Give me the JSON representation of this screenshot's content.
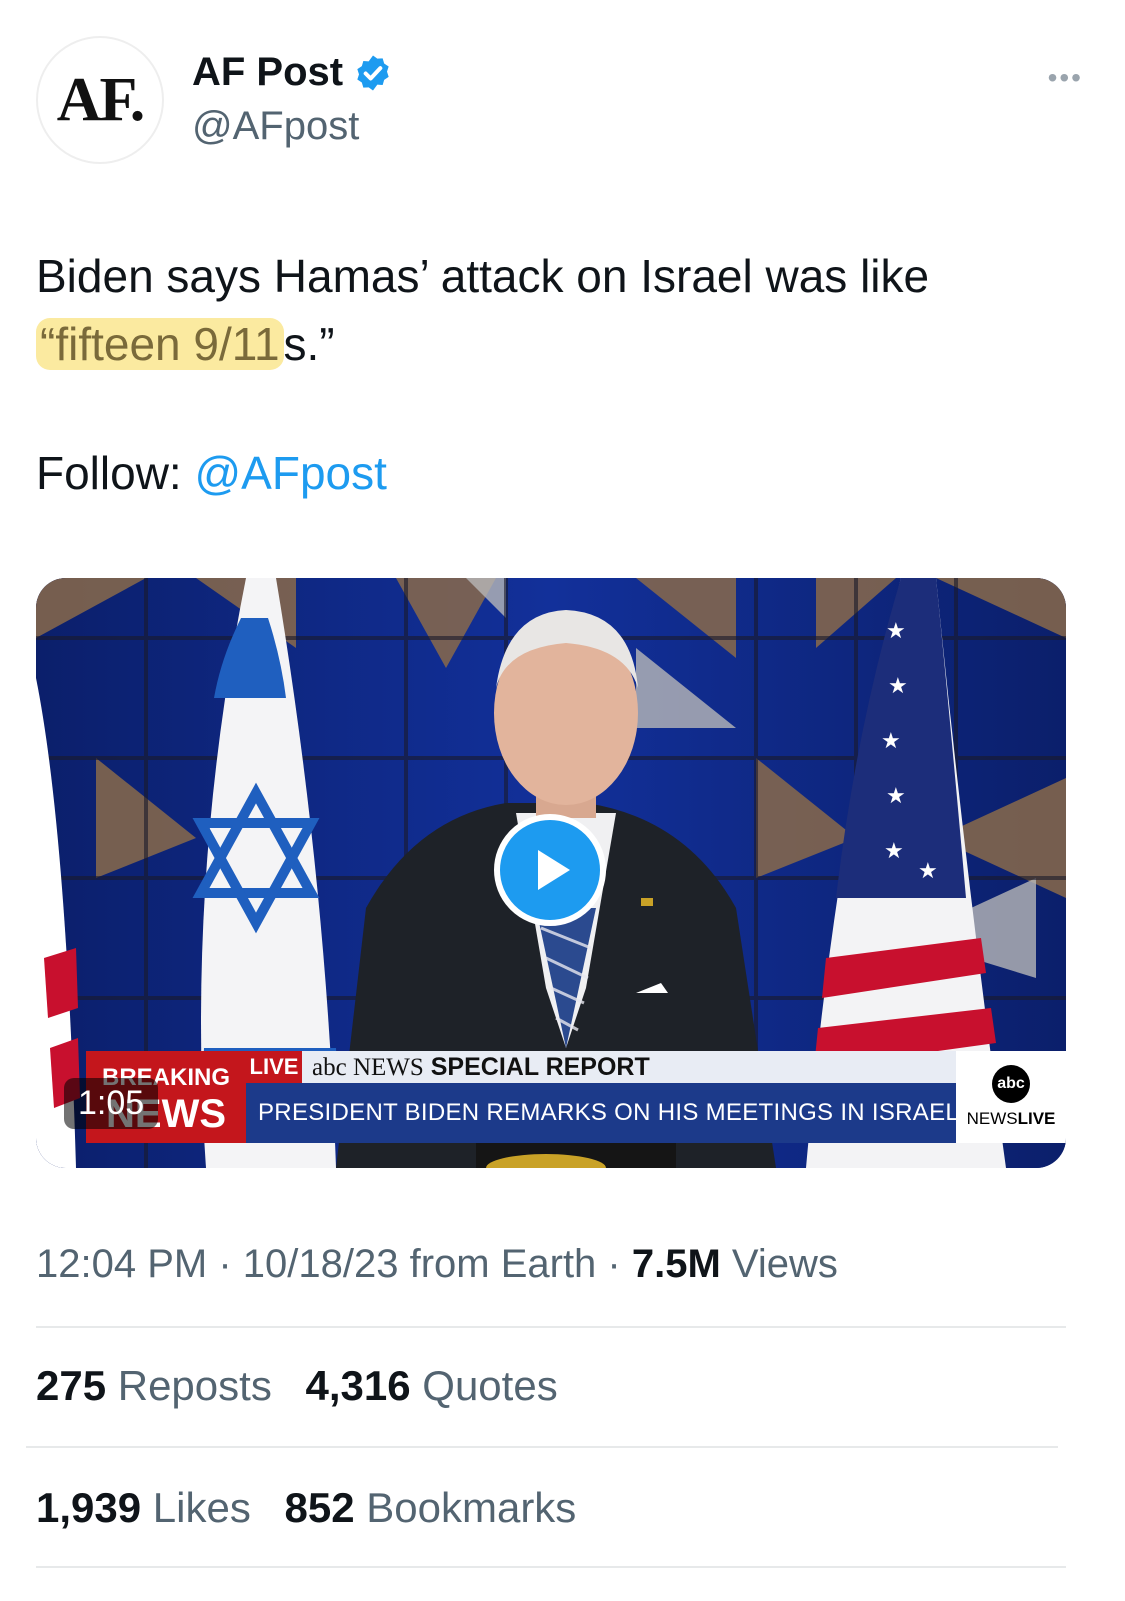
{
  "account": {
    "avatar_text": "AF.",
    "display_name": "AF Post",
    "handle": "@AFpost",
    "more_label": "•••"
  },
  "tweet": {
    "text_before": "Biden says Hamas’ attack on Israel was like ",
    "highlighted": "“fifteen 9/11",
    "text_after": "s.”",
    "follow_label": "Follow: ",
    "follow_mention": "@AFpost"
  },
  "media": {
    "duration": "1:05",
    "breaking_top": "BREAKING",
    "breaking_bottom": "NEWS",
    "live": "LIVE",
    "network": "abc NEWS",
    "special_report": "SPECIAL REPORT",
    "headline": "PRESIDENT BIDEN REMARKS ON HIS MEETINGS IN ISRAEL",
    "logo_circle": "abc",
    "logo_news": "NEWS",
    "logo_live": "LIVE",
    "play_icon": "play-icon"
  },
  "meta": {
    "time": "12:04 PM",
    "sep": " · ",
    "date": "10/18/23",
    "source": " from Earth",
    "views_count": "7.5M",
    "views_label": " Views"
  },
  "stats": {
    "reposts_count": "275",
    "reposts_label": " Reposts",
    "quotes_count": "4,316",
    "quotes_label": " Quotes",
    "likes_count": "1,939",
    "likes_label": " Likes",
    "bookmarks_count": "852",
    "bookmarks_label": " Bookmarks"
  },
  "colors": {
    "link": "#1d9bf0",
    "secondary_text": "#536471",
    "highlight": "#fbeaa0"
  }
}
